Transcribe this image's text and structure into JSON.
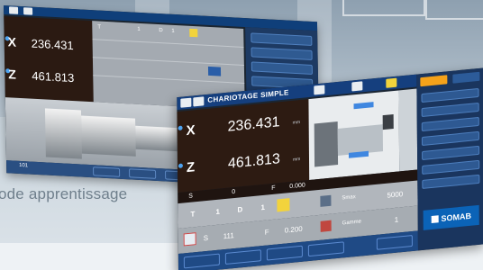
{
  "caption": "ode apprentissage",
  "back_screen": {
    "axes": [
      {
        "axis": "X",
        "value": "236.431"
      },
      {
        "axis": "Z",
        "value": "461.813"
      }
    ],
    "bottom_value": "101"
  },
  "front_screen": {
    "title": "CHARIOTAGE SIMPLE",
    "axes": [
      {
        "axis": "X",
        "value": "236.431",
        "unit": "mm"
      },
      {
        "axis": "Z",
        "value": "461.813",
        "unit": "mm"
      }
    ],
    "status_row": {
      "s_label": "S",
      "s_value": "0",
      "f_label": "F",
      "f_value": "0.000"
    },
    "tool_row": {
      "t_label": "T",
      "t_value": "1",
      "d_label": "D",
      "d_value": "1",
      "smax_label": "Smax",
      "smax_value": "5000"
    },
    "spindle_row": {
      "s_label": "S",
      "s_value": "111",
      "f_label": "F",
      "f_value": "0.200",
      "gamme_label": "Gamme",
      "gamme_value": "1"
    },
    "brand": "SOMAB"
  },
  "colors": {
    "title_bar": "#153f7e",
    "panel": "#1a355e",
    "accent_orange": "#f5a21a",
    "coord_bg": "#2d1b12"
  }
}
